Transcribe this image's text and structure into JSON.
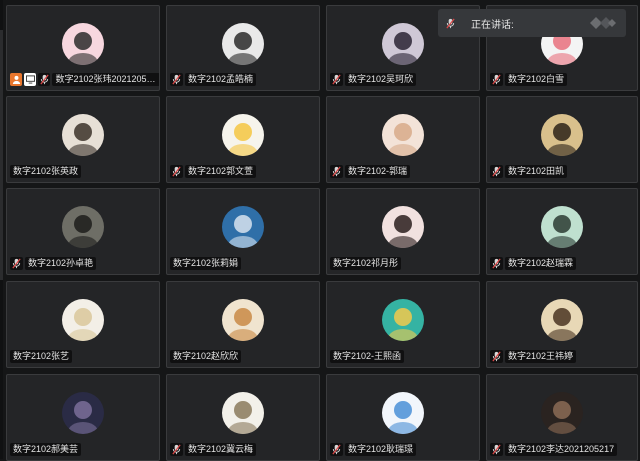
{
  "toast": {
    "label": "正在讲话:"
  },
  "participants": [
    {
      "name": "数字2102张玮202120523...",
      "mic": true,
      "host": true,
      "share": true,
      "avatar": "cartoon-girl-pink",
      "colors": [
        "#f7d7df",
        "#2b2b2b"
      ]
    },
    {
      "name": "数字2102孟皓楠",
      "mic": true,
      "avatar": "anime-bw",
      "colors": [
        "#e9e9e9",
        "#2a2a2a"
      ]
    },
    {
      "name": "数字2102吴珂欣",
      "mic": true,
      "avatar": "anime-dark",
      "colors": [
        "#cfc8d6",
        "#2a2334"
      ]
    },
    {
      "name": "数字2102白雪",
      "mic": true,
      "avatar": "pink-heart",
      "colors": [
        "#f4f4f4",
        "#e8707d"
      ]
    },
    {
      "name": "数字2102张英政",
      "mic": false,
      "avatar": "white-tiger",
      "colors": [
        "#e7e0d6",
        "#3b3129"
      ]
    },
    {
      "name": "数字2102郭文萱",
      "mic": true,
      "avatar": "yellow-face",
      "colors": [
        "#f6f4ec",
        "#f5c542"
      ]
    },
    {
      "name": "数字2102-郭瑞",
      "mic": true,
      "avatar": "blonde-girl",
      "colors": [
        "#f3e3d8",
        "#d7aa8a"
      ]
    },
    {
      "name": "数字2102田凯",
      "mic": true,
      "avatar": "panda",
      "colors": [
        "#d9c08c",
        "#2b2217"
      ]
    },
    {
      "name": "数字2102孙卓艳",
      "mic": true,
      "avatar": "dark-photo",
      "colors": [
        "#6e6e66",
        "#1d1d1b"
      ]
    },
    {
      "name": "数字2102张莉娟",
      "mic": false,
      "avatar": "blue-scene",
      "colors": [
        "#2f6fa8",
        "#d7e3ee"
      ]
    },
    {
      "name": "数字2102祁月彤",
      "mic": false,
      "avatar": "anime-redlips",
      "colors": [
        "#f1e1df",
        "#2a1d1d"
      ]
    },
    {
      "name": "数字2102赵瑞霖",
      "mic": true,
      "avatar": "anime-green",
      "colors": [
        "#bfe0cf",
        "#2b3b33"
      ]
    },
    {
      "name": "数字2102张艺",
      "mic": false,
      "avatar": "anime-blonde",
      "colors": [
        "#f3efe7",
        "#d9c79a"
      ]
    },
    {
      "name": "数字2102赵欣欣",
      "mic": false,
      "avatar": "shiba-dog",
      "colors": [
        "#f0e4cf",
        "#c98a45"
      ]
    },
    {
      "name": "数字2102-王熙函",
      "mic": false,
      "avatar": "teal-hat",
      "colors": [
        "#35b3a3",
        "#f2c94c"
      ]
    },
    {
      "name": "数字2102王祎婷",
      "mic": true,
      "avatar": "straw-hat",
      "colors": [
        "#e8d8b6",
        "#4a3522"
      ]
    },
    {
      "name": "数字2102郝美芸",
      "mic": false,
      "avatar": "night-photo",
      "colors": [
        "#2a2b45",
        "#7b6f9a"
      ]
    },
    {
      "name": "数字2102冀云梅",
      "mic": true,
      "avatar": "white-cat",
      "colors": [
        "#f3f1ea",
        "#8a7a5c"
      ]
    },
    {
      "name": "数字2102耿瑞璟",
      "mic": true,
      "avatar": "blue-bird",
      "colors": [
        "#f2f6fb",
        "#4a8fd6"
      ]
    },
    {
      "name": "数字2102李达2021205217",
      "mic": true,
      "avatar": "dark-portrait",
      "colors": [
        "#2a2320",
        "#8b6b56"
      ]
    }
  ]
}
